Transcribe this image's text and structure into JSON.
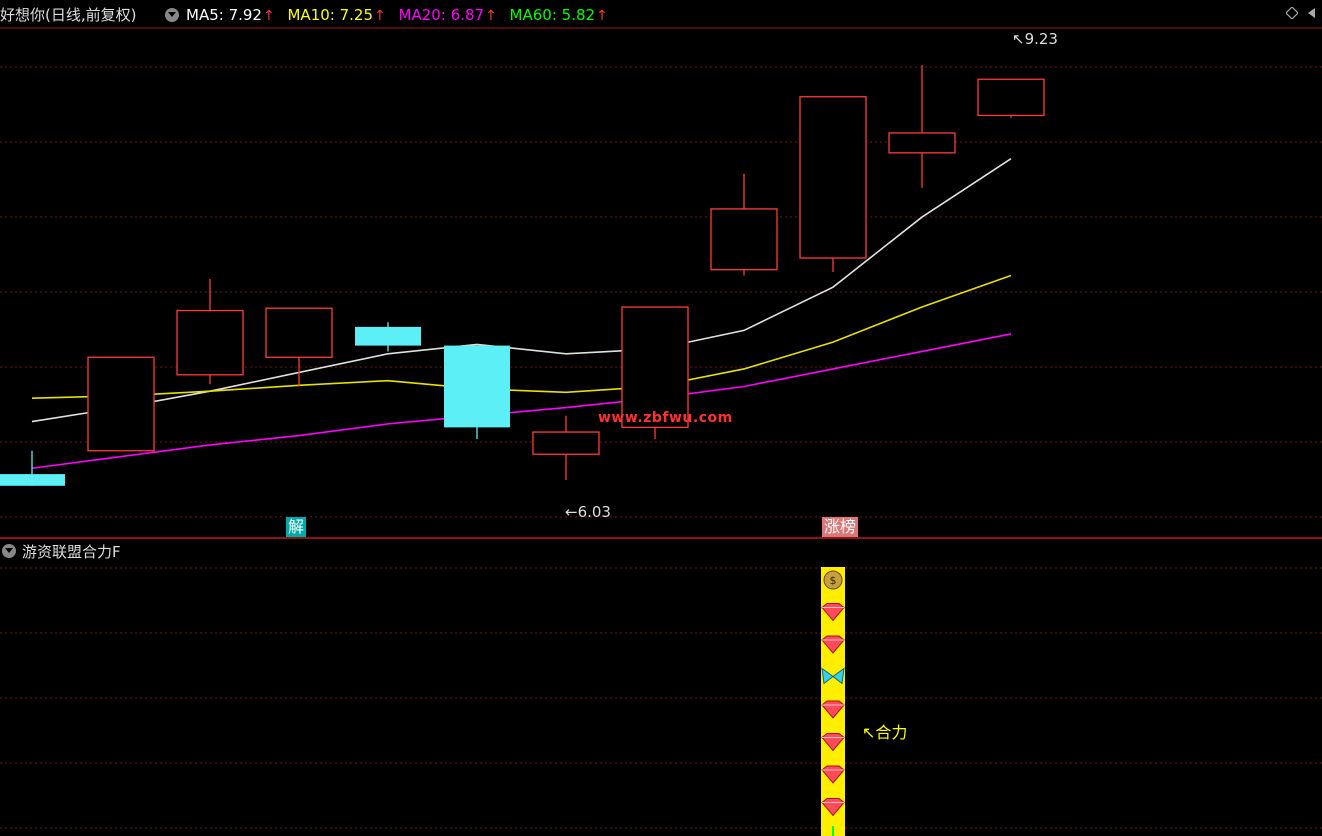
{
  "header": {
    "stock_name": "好想你(日线,前复权)",
    "ma": [
      {
        "label": "MA5: 7.92",
        "color": "#ffffff"
      },
      {
        "label": "MA10: 7.25",
        "color": "#ffff00"
      },
      {
        "label": "MA20: 6.87",
        "color": "#ff00ff"
      },
      {
        "label": "MA60: 5.82",
        "color": "#00ff00"
      }
    ],
    "up_arrow": "↑"
  },
  "price_panel": {
    "high_label": "9.23",
    "low_label": "6.03",
    "tags": [
      {
        "text": "解",
        "bg": "#00a0a0",
        "color": "#ffffff"
      },
      {
        "text": "涨榜",
        "bg": "#e08080",
        "color": "#ffffff"
      }
    ],
    "watermark": "www.zbfwu.com"
  },
  "sub_panel": {
    "title": "游资联盟合力F",
    "indicator_label": "合力"
  },
  "chart_data": {
    "type": "candlestick",
    "ylim": [
      5.5,
      9.6
    ],
    "candles": [
      {
        "open": 5.85,
        "close": 5.75,
        "high": 6.05,
        "low": 5.75,
        "color": "cyan"
      },
      {
        "open": 6.05,
        "close": 6.85,
        "high": 6.85,
        "low": 6.05,
        "color": "red"
      },
      {
        "open": 6.7,
        "close": 7.25,
        "high": 7.52,
        "low": 6.62,
        "color": "red"
      },
      {
        "open": 6.85,
        "close": 7.27,
        "high": 7.27,
        "low": 6.6,
        "color": "red"
      },
      {
        "open": 7.11,
        "close": 6.95,
        "high": 7.15,
        "low": 6.9,
        "color": "cyan"
      },
      {
        "open": 6.95,
        "close": 6.25,
        "high": 6.95,
        "low": 6.15,
        "color": "cyan"
      },
      {
        "open": 6.02,
        "close": 6.21,
        "high": 6.35,
        "low": 5.8,
        "color": "red"
      },
      {
        "open": 6.25,
        "close": 7.28,
        "high": 7.28,
        "low": 6.15,
        "color": "red"
      },
      {
        "open": 7.6,
        "close": 8.12,
        "high": 8.42,
        "low": 7.55,
        "color": "red"
      },
      {
        "open": 7.7,
        "close": 9.08,
        "high": 9.08,
        "low": 7.58,
        "color": "red"
      },
      {
        "open": 8.6,
        "close": 8.77,
        "high": 9.35,
        "low": 8.3,
        "color": "red"
      },
      {
        "open": 8.92,
        "close": 9.23,
        "high": 9.23,
        "low": 8.9,
        "color": "red",
        "note": "body drawn 9.23 high"
      }
    ],
    "ma_series": [
      {
        "name": "MA5",
        "color": "#e0e0e0",
        "values": [
          6.3,
          6.42,
          6.56,
          6.72,
          6.88,
          6.96,
          6.88,
          6.92,
          7.08,
          7.45,
          8.05,
          8.55
        ]
      },
      {
        "name": "MA10",
        "color": "#e8e000",
        "values": [
          6.5,
          6.52,
          6.56,
          6.61,
          6.65,
          6.58,
          6.55,
          6.6,
          6.75,
          6.98,
          7.28,
          7.55
        ]
      },
      {
        "name": "MA20",
        "color": "#ff00ff",
        "values": [
          5.9,
          6.0,
          6.1,
          6.18,
          6.28,
          6.35,
          6.42,
          6.5,
          6.6,
          6.75,
          6.9,
          7.05
        ]
      }
    ],
    "indicator_stack": {
      "bar_color": "#ffee00",
      "icons": [
        "money-bag",
        "heart",
        "heart",
        "butterfly",
        "heart",
        "heart",
        "heart",
        "heart"
      ]
    }
  }
}
